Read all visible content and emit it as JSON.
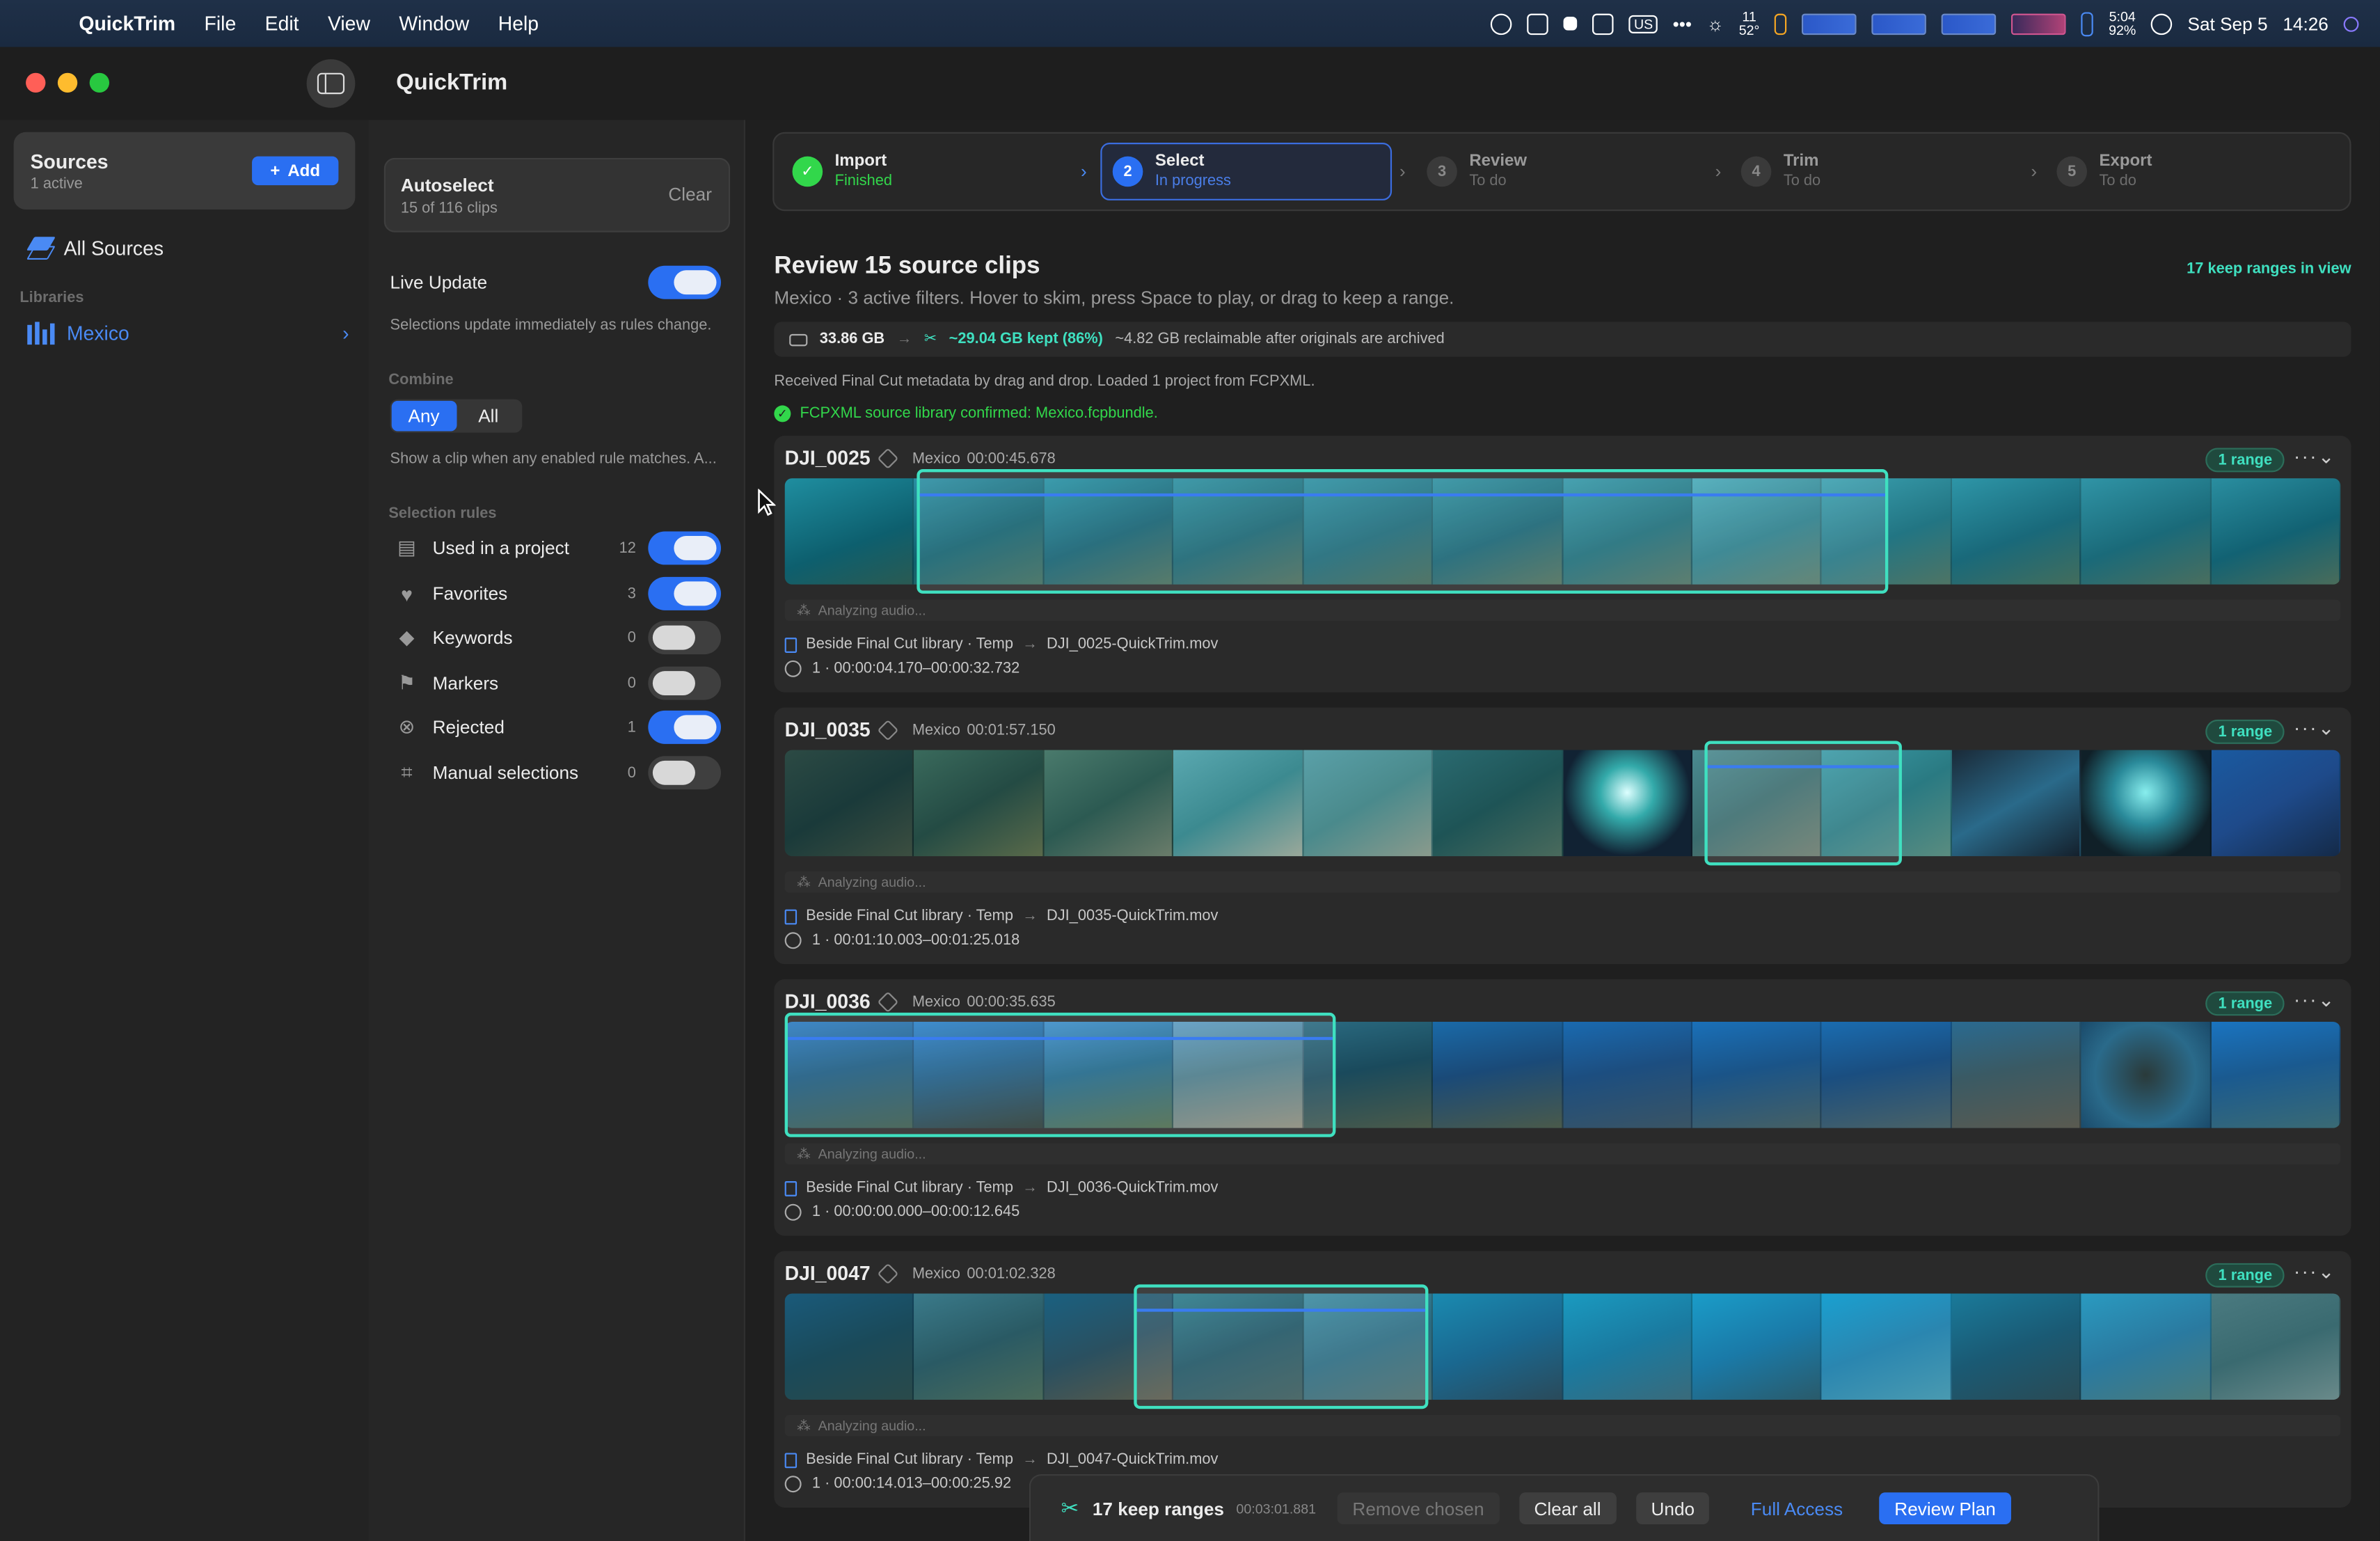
{
  "menubar": {
    "app": "QuickTrim",
    "items": [
      "File",
      "Edit",
      "View",
      "Window",
      "Help"
    ],
    "status": {
      "temp_top": "11",
      "temp_bottom": "52°",
      "battery_time": "5:04",
      "battery_pct": "92%",
      "keyboard": "US",
      "date": "Sat Sep 5",
      "time": "14:26"
    }
  },
  "window": {
    "title": "QuickTrim"
  },
  "sidebar": {
    "sources_title": "Sources",
    "sources_sub": "1 active",
    "add_label": "Add",
    "all_sources": "All Sources",
    "libraries_head": "Libraries",
    "library": "Mexico"
  },
  "rules": {
    "autoselect_title": "Autoselect",
    "autoselect_sub": "15 of 116 clips",
    "clear": "Clear",
    "live_update": "Live Update",
    "live_update_desc": "Selections update immediately as rules change.",
    "combine_head": "Combine",
    "combine_any": "Any",
    "combine_all": "All",
    "combine_desc": "Show a clip when any enabled rule matches. A...",
    "selection_head": "Selection rules",
    "items": [
      {
        "label": "Used in a project",
        "count": "12",
        "on": true
      },
      {
        "label": "Favorites",
        "count": "3",
        "on": true
      },
      {
        "label": "Keywords",
        "count": "0",
        "on": false
      },
      {
        "label": "Markers",
        "count": "0",
        "on": false
      },
      {
        "label": "Rejected",
        "count": "1",
        "on": true
      },
      {
        "label": "Manual selections",
        "count": "0",
        "on": false
      }
    ]
  },
  "steps": [
    {
      "title": "Import",
      "status": "Finished",
      "num": "✓"
    },
    {
      "title": "Select",
      "status": "In progress",
      "num": "2"
    },
    {
      "title": "Review",
      "status": "To do",
      "num": "3"
    },
    {
      "title": "Trim",
      "status": "To do",
      "num": "4"
    },
    {
      "title": "Export",
      "status": "To do",
      "num": "5"
    }
  ],
  "main": {
    "title": "Review 15 source clips",
    "subtitle": "Mexico · 3 active filters. Hover to skim, press Space to play, or drag to keep a range.",
    "keep_in_view": "17 keep ranges in view",
    "storage_total": "33.86 GB",
    "storage_kept": "~29.04 GB kept (86%)",
    "storage_reclaim": "~4.82 GB reclaimable after originals are archived",
    "info_fcp": "Received Final Cut metadata by drag and drop. Loaded 1 project from FCPXML.",
    "info_confirm": "FCPXML source library confirmed: Mexico.fcpbundle."
  },
  "clips": [
    {
      "name": "DJI_0025",
      "library": "Mexico",
      "duration": "00:00:45.678",
      "range_badge": "1 range",
      "audio": "Analyzing audio...",
      "dest_lib": "Beside Final Cut library · Temp",
      "dest_file": "DJI_0025-QuickTrim.mov",
      "range": "1 · 00:00:04.170–00:00:32.732"
    },
    {
      "name": "DJI_0035",
      "library": "Mexico",
      "duration": "00:01:57.150",
      "range_badge": "1 range",
      "audio": "Analyzing audio...",
      "dest_lib": "Beside Final Cut library · Temp",
      "dest_file": "DJI_0035-QuickTrim.mov",
      "range": "1 · 00:01:10.003–00:01:25.018"
    },
    {
      "name": "DJI_0036",
      "library": "Mexico",
      "duration": "00:00:35.635",
      "range_badge": "1 range",
      "audio": "Analyzing audio...",
      "dest_lib": "Beside Final Cut library · Temp",
      "dest_file": "DJI_0036-QuickTrim.mov",
      "range": "1 · 00:00:00.000–00:00:12.645"
    },
    {
      "name": "DJI_0047",
      "library": "Mexico",
      "duration": "00:01:02.328",
      "range_badge": "1 range",
      "audio": "Analyzing audio...",
      "dest_lib": "Beside Final Cut library · Temp",
      "dest_file": "DJI_0047-QuickTrim.mov",
      "range": "1 · 00:00:14.013–00:00:25.92"
    }
  ],
  "bottom": {
    "keep_ranges": "17 keep ranges",
    "duration": "00:03:01.881",
    "remove": "Remove chosen",
    "clear_all": "Clear all",
    "undo": "Undo",
    "full_access": "Full Access",
    "review_plan": "Review Plan"
  }
}
